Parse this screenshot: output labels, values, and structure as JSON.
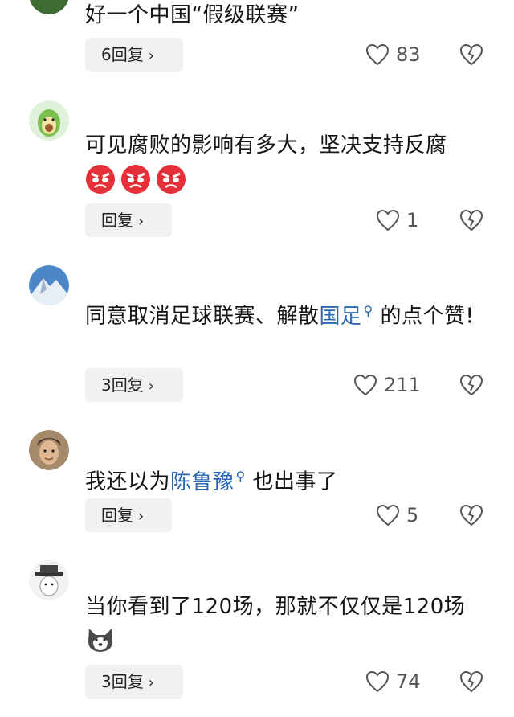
{
  "comments": [
    {
      "username": "",
      "text": "好一个中国“假级联赛”",
      "reply_label": "6回复",
      "likes": "83"
    },
    {
      "username": "",
      "text": "可见腐败的影响有多大，坚决支持反腐",
      "emojis": [
        "angry-face-icon",
        "angry-face-icon",
        "angry-face-icon"
      ],
      "reply_label": "回复",
      "likes": "1"
    },
    {
      "username": "",
      "text_before": "同意取消足球联赛、解散",
      "link": "国足",
      "text_after": " 的点个赞!",
      "reply_label": "3回复",
      "likes": "211"
    },
    {
      "username": "",
      "text_before": "我还以为",
      "link": "陈鲁豫",
      "text_after": " 也出事了",
      "reply_label": "回复",
      "likes": "5"
    },
    {
      "username": "",
      "text": "当你看到了120场，那就不仅仅是120场",
      "emojis": [
        "dog-face-icon"
      ],
      "reply_label": "3回复",
      "likes": "74"
    }
  ],
  "colors": {
    "link": "#2b67b0",
    "reply_bg": "#f1f1f1",
    "text": "#151515",
    "muted": "#555555"
  },
  "icons": {
    "like": "heart-outline-icon",
    "dislike": "broken-heart-icon",
    "chevron": "chevron-right-icon",
    "search": "search-icon"
  },
  "glyphs": {
    "chevron": "›"
  }
}
